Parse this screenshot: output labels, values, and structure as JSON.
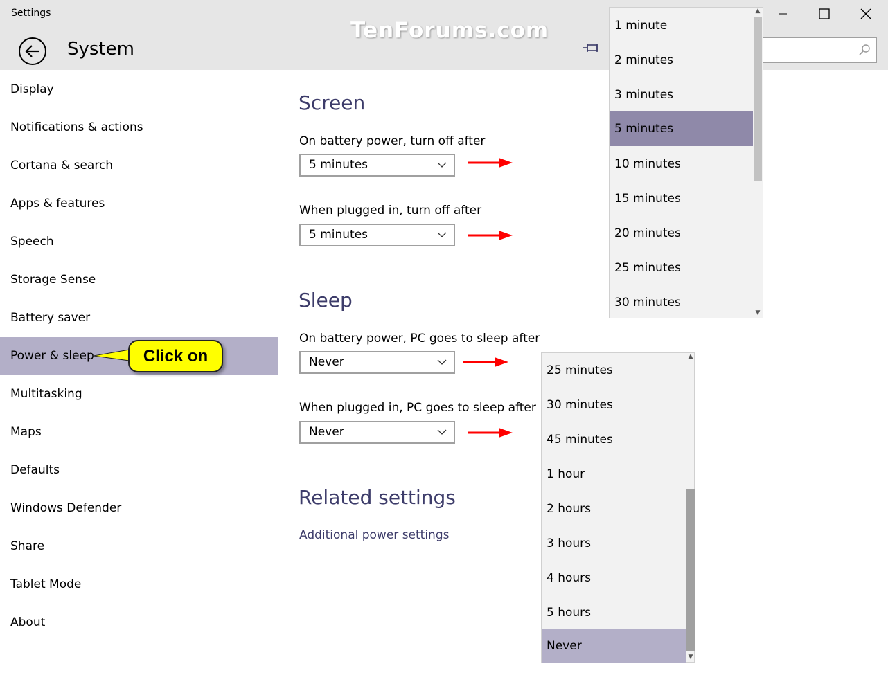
{
  "window": {
    "app_title": "Settings",
    "watermark": "TenForums.com"
  },
  "header": {
    "title": "System"
  },
  "sidebar": {
    "items": [
      {
        "label": "Display"
      },
      {
        "label": "Notifications & actions"
      },
      {
        "label": "Cortana & search"
      },
      {
        "label": "Apps & features"
      },
      {
        "label": "Speech"
      },
      {
        "label": "Storage Sense"
      },
      {
        "label": "Battery saver"
      },
      {
        "label": "Power & sleep"
      },
      {
        "label": "Multitasking"
      },
      {
        "label": "Maps"
      },
      {
        "label": "Defaults"
      },
      {
        "label": "Windows Defender"
      },
      {
        "label": "Share"
      },
      {
        "label": "Tablet Mode"
      },
      {
        "label": "About"
      }
    ],
    "active_index": 7,
    "callout": "Click on"
  },
  "screen": {
    "heading": "Screen",
    "battery_label": "On battery power, turn off after",
    "battery_value": "5 minutes",
    "plugged_label": "When plugged in, turn off after",
    "plugged_value": "5 minutes"
  },
  "sleep": {
    "heading": "Sleep",
    "battery_label": "On battery power, PC goes to sleep after",
    "battery_value": "Never",
    "plugged_label": "When plugged in, PC goes to sleep after",
    "plugged_value": "Never"
  },
  "related": {
    "heading": "Related settings",
    "link": "Additional power settings"
  },
  "screen_dropdown": {
    "options": [
      "1 minute",
      "2 minutes",
      "3 minutes",
      "5 minutes",
      "10 minutes",
      "15 minutes",
      "20 minutes",
      "25 minutes",
      "30 minutes"
    ],
    "selected": "5 minutes"
  },
  "sleep_dropdown": {
    "options": [
      "25 minutes",
      "30 minutes",
      "45 minutes",
      "1 hour",
      "2 hours",
      "3 hours",
      "4 hours",
      "5 hours",
      "Never"
    ],
    "selected": "Never"
  },
  "colors": {
    "accent": "#3d3c6a",
    "nav_active": "#b3afc8",
    "dropdown_selected": "#8f89a9",
    "callout": "#ffff00",
    "arrow": "#ff0000"
  }
}
